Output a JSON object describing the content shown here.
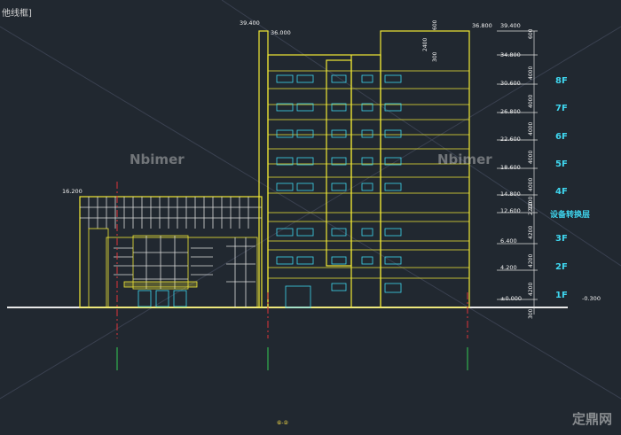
{
  "window": {
    "title_fragment": "他线框]"
  },
  "watermarks": {
    "left": "Nbimer",
    "right": "Nbimer",
    "corner": "定鼎网"
  },
  "floors": [
    "8F",
    "7F",
    "6F",
    "5F",
    "4F",
    "3F",
    "2F",
    "1F"
  ],
  "transfer_floor": "设备转换层",
  "elevations_right": [
    "39.400",
    "34.800",
    "30.600",
    "26.800",
    "22.600",
    "18.600",
    "14.800",
    "12.600",
    "6.400",
    "4.200",
    "±0.000",
    "-0.300"
  ],
  "elevations_left": [
    "39.400",
    "36.000",
    "16.200",
    "36.800"
  ],
  "dimensions_right": [
    "600",
    "4000",
    "4000",
    "4000",
    "4000",
    "4000",
    "2200",
    "4200",
    "2200",
    "4200",
    "4200",
    "300"
  ],
  "dimensions_top": [
    "2400",
    "300",
    "600"
  ],
  "axis_label": "⑥-②",
  "colors": {
    "background": "#212830",
    "outline": "#f2e935",
    "window": "#3fd6ef",
    "line": "#dcdcdc",
    "axis": "#e0333a",
    "axis_mark": "#33cc55"
  }
}
